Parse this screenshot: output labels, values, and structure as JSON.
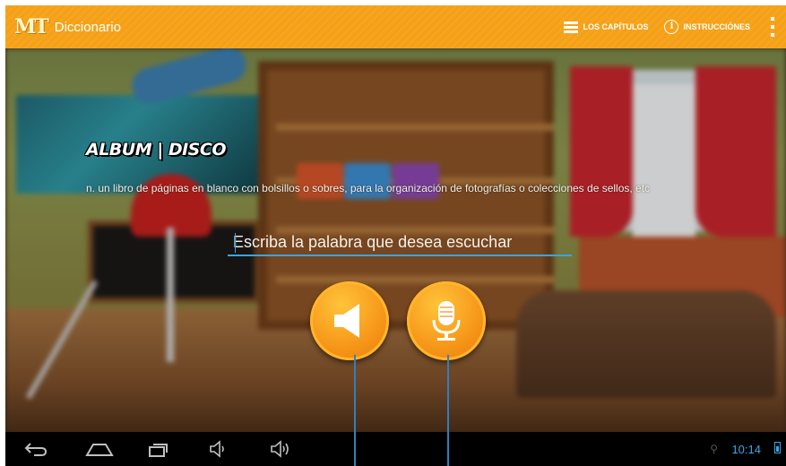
{
  "actionbar": {
    "logo_text": "MT",
    "app_title": "Diccionario",
    "chapters_label": "LOS CAPÍTULOS",
    "instructions_label": "INSTRUCCIÓNES",
    "bg_color": "#f7a51d",
    "icons": [
      "list-icon",
      "info-icon",
      "overflow-menu-icon"
    ]
  },
  "content": {
    "word_left": "ALBUM",
    "word_separator": "|",
    "word_right": "DISCO",
    "definition": "n. un libro de páginas en blanco con bolsillos o sobres, para la organización de fotografías o colecciones de sellos, etc",
    "input_placeholder": "Escriba la palabra que desea escuchar",
    "input_value": "",
    "buttons": [
      "speaker-icon",
      "microphone-icon"
    ],
    "accent_color": "#3da3e0",
    "button_color": "#f7991a"
  },
  "navbar": {
    "buttons": [
      "back-icon",
      "home-icon",
      "recents-icon",
      "volume-down-icon",
      "volume-up-icon"
    ],
    "status_icons": [
      "usb-icon",
      "battery-icon"
    ],
    "clock": "10:14",
    "clock_color": "#3aa8e8"
  }
}
